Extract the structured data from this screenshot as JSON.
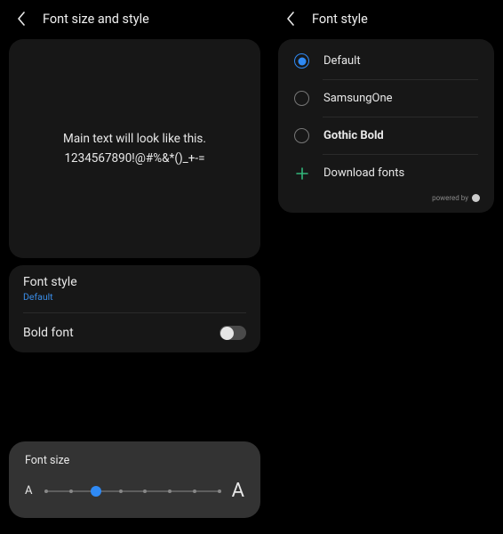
{
  "left": {
    "title": "Font size and style",
    "preview": {
      "line1": "Main text will look like this.",
      "line2": "1234567890!@#%&*()_+-="
    },
    "font_style": {
      "label": "Font style",
      "value": "Default"
    },
    "bold_font": {
      "label": "Bold font",
      "enabled": false
    },
    "font_size": {
      "label": "Font size",
      "small_indicator": "A",
      "large_indicator": "A",
      "steps": 8,
      "current_step": 2
    }
  },
  "right": {
    "title": "Font style",
    "options": [
      {
        "label": "Default",
        "selected": true,
        "bold": false
      },
      {
        "label": "SamsungOne",
        "selected": false,
        "bold": false
      },
      {
        "label": "Gothic Bold",
        "selected": false,
        "bold": true
      }
    ],
    "download": {
      "label": "Download fonts"
    },
    "powered_by": "powered by"
  },
  "colors": {
    "accent": "#2f8af5",
    "download_green": "#32b67a"
  }
}
